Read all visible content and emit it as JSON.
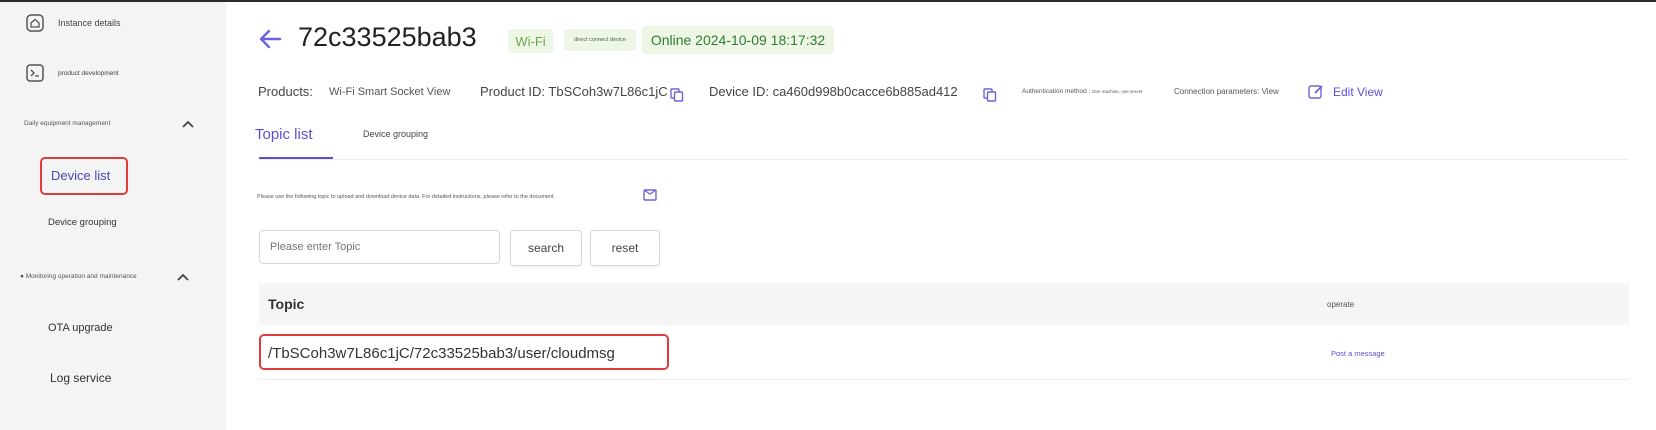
{
  "sidebar": {
    "items": [
      {
        "label": "Instance details",
        "icon": "home-icon"
      },
      {
        "label": "product development",
        "icon": "terminal-icon"
      }
    ],
    "groups": [
      {
        "label": "Daily equipment management",
        "children": [
          "Device list",
          "Device grouping"
        ]
      },
      {
        "label": "Monitoring operation and maintenance",
        "children": [
          "OTA upgrade",
          "Log service"
        ]
      }
    ],
    "active": "Device list"
  },
  "header": {
    "device_name": "72c33525bab3",
    "net_badge": "Wi-Fi",
    "connect_badge": "direct connect device",
    "status": "Online 2024-10-09 18:17:32"
  },
  "meta": {
    "products_label": "Products:",
    "products_value": "Wi-Fi Smart Socket View",
    "product_id": "Product ID: TbSCoh3w7L86c1jC",
    "device_id": "Device ID: ca460d998b0cacce6b885ad412",
    "auth_label": "Authentication method :",
    "auth_value": "One machine, one secret",
    "conn_params": "Connection parameters: View",
    "edit": "Edit View"
  },
  "tabs": [
    "Topic list",
    "Device grouping"
  ],
  "info_text": "Please use the following topic to upload and download device data. For detailed instructions, please refer to the document",
  "search": {
    "placeholder": "Please enter Topic",
    "search_label": "search",
    "reset_label": "reset"
  },
  "table": {
    "headers": {
      "topic": "Topic",
      "operate": "operate"
    },
    "rows": [
      {
        "topic": "/TbSCoh3w7L86c1jC/72c33525bab3/user/cloudmsg",
        "action": "Post a message"
      }
    ]
  },
  "colors": {
    "accent": "#5b4fd6",
    "online_green": "#2f7d32",
    "highlight": "#e23b3b",
    "sidebar_bg": "#f4f4f5"
  }
}
